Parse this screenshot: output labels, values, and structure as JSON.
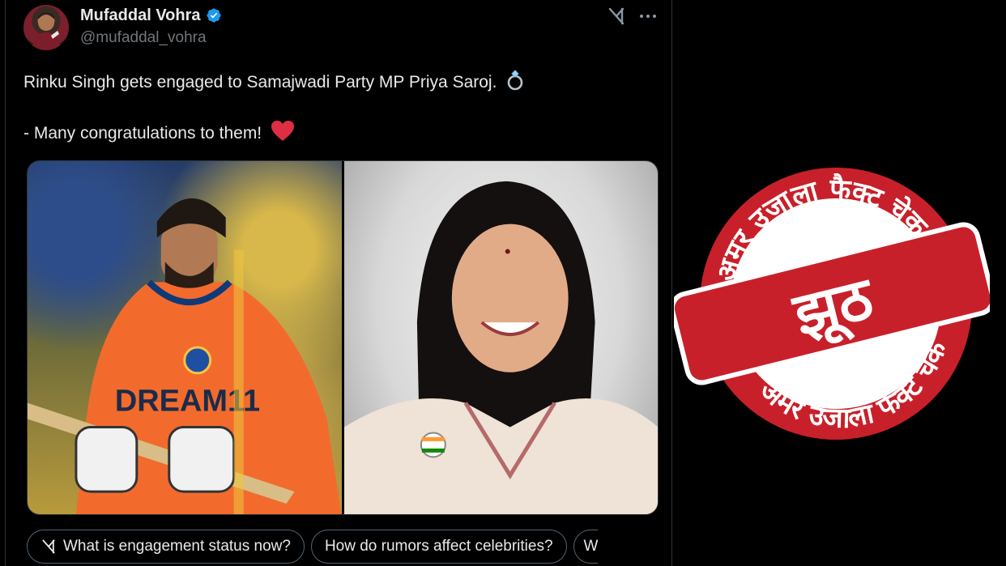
{
  "tweet": {
    "author_name": "Mufaddal Vohra",
    "author_handle": "@mufaddal_vohra",
    "line1": "Rinku Singh gets engaged to Samajwadi Party MP Priya Saroj.",
    "line2": "- Many congratulations to them!",
    "line1_emoji": "ring-emoji",
    "line2_emoji": "red-heart-emoji",
    "media": [
      {
        "label": "DREAM11"
      },
      {
        "label": ""
      }
    ]
  },
  "grok_prompts": [
    {
      "label": "What is engagement status now?"
    },
    {
      "label": "How do rumors affect celebrities?"
    },
    {
      "label": "W"
    }
  ],
  "stamp": {
    "top_arc_text": "अमर उजाला फैक्ट चेक",
    "bottom_arc_text": "अमर उजाला फैक्ट चेक",
    "verdict": "झूठ"
  },
  "colors": {
    "background": "#000000",
    "text": "#e7e9ea",
    "secondary_text": "#71767b",
    "verified": "#1d9bf0",
    "stamp_red": "#c8202a",
    "heart": "#f91880"
  }
}
